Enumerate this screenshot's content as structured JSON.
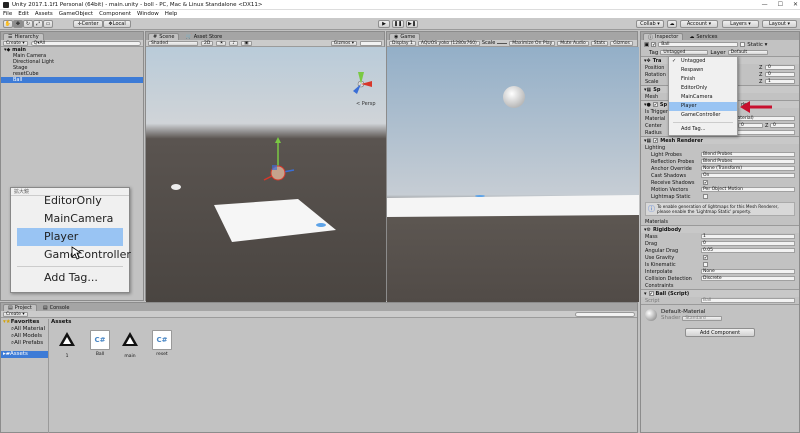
{
  "window": {
    "title": "Unity 2017.1.1f1 Personal (64bit) - main.unity - boll - PC, Mac & Linux Standalone <DX11>",
    "controls": [
      "—",
      "☐",
      "✕"
    ]
  },
  "menu": [
    "File",
    "Edit",
    "Assets",
    "GameObject",
    "Component",
    "Window",
    "Help"
  ],
  "toolbar": {
    "center_label": "Center",
    "local_label": "Local",
    "collab_label": "Collab ▾",
    "account_label": "Account ▾",
    "layers_label": "Layers ▾",
    "layout_label": "Layout ▾"
  },
  "hierarchy": {
    "tab": "Hierarchy",
    "create_label": "Create ▾",
    "search_placeholder": "Q▾All",
    "scene_name": "main",
    "items": [
      "Main Camera",
      "Directional Light",
      "Stage",
      "resetCube",
      "Ball"
    ],
    "selected": "Ball"
  },
  "scene": {
    "tab_scene": "Scene",
    "tab_asset_store": "Asset Store",
    "shading": "Shaded",
    "mode_2d": "2D",
    "gizmos": "Gizmos ▾",
    "persp": "< Persp"
  },
  "game": {
    "tab": "Game",
    "display": "Display 1",
    "resolution": "AQUOS yoko (1280x760)",
    "scale": "Scale",
    "maximize": "Maximize On Play",
    "mute": "Mute Audio",
    "stats": "Stats",
    "gizmos": "Gizmos"
  },
  "zoom_popup": {
    "header": "拡大鏡",
    "items": [
      "EditorOnly",
      "MainCamera",
      "Player",
      "GameController",
      "Add Tag..."
    ],
    "selected": "Player"
  },
  "project": {
    "tab_project": "Project",
    "tab_console": "Console",
    "create_label": "Create ▾",
    "favorites_label": "Favorites",
    "favorites": [
      "All Material",
      "All Models",
      "All Prefabs"
    ],
    "assets_root": "Assets",
    "assets_header": "Assets",
    "assets": [
      {
        "name": "1",
        "icon": "unity-scene-icon"
      },
      {
        "name": "Ball",
        "icon": "csharp-script-icon"
      },
      {
        "name": "main",
        "icon": "unity-scene-icon"
      },
      {
        "name": "reset",
        "icon": "csharp-script-icon"
      }
    ]
  },
  "inspector": {
    "tab_inspector": "Inspector",
    "tab_services": "Services",
    "object_name": "Ball",
    "static_label": "Static ▾",
    "tag_label": "Tag",
    "tag_value": "Untagged",
    "layer_label": "Layer",
    "layer_value": "Default",
    "transform": {
      "title": "Tra",
      "position": {
        "label": "Position",
        "z": "0"
      },
      "rotation": {
        "label": "Rotation",
        "z": "0"
      },
      "scale": {
        "label": "Scale",
        "z": "1"
      }
    },
    "mesh_title": "Sp",
    "mesh_label": "Mesh",
    "collider_title": "Sp",
    "collider_suffix": "der",
    "is_trigger_label": "Is Trigger",
    "material_label": "Material",
    "material_value": "None (Physic Material)",
    "center_label": "Center",
    "center": {
      "x": "0",
      "y": "0",
      "z": "0"
    },
    "radius_label": "Radius",
    "radius_value": "0.5",
    "mesh_renderer": {
      "title": "Mesh Renderer",
      "lighting": "Lighting",
      "rows": [
        {
          "label": "Light Probes",
          "value": "Blend Probes"
        },
        {
          "label": "Reflection Probes",
          "value": "Blend Probes"
        },
        {
          "label": "Anchor Override",
          "value": "None (Transform)"
        },
        {
          "label": "Cast Shadows",
          "value": "On"
        },
        {
          "label": "Receive Shadows",
          "value": "✔"
        },
        {
          "label": "Motion Vectors",
          "value": "Per Object Motion"
        },
        {
          "label": "Lightmap Static",
          "value": ""
        }
      ],
      "info": "To enable generation of lightmaps for this Mesh Renderer, please enable the 'Lightmap Static' property.",
      "materials": "Materials"
    },
    "rigidbody": {
      "title": "Rigidbody",
      "rows": [
        {
          "label": "Mass",
          "value": "1"
        },
        {
          "label": "Drag",
          "value": "0"
        },
        {
          "label": "Angular Drag",
          "value": "0.05"
        },
        {
          "label": "Use Gravity",
          "value": "✔"
        },
        {
          "label": "Is Kinematic",
          "value": ""
        },
        {
          "label": "Interpolate",
          "value": "None"
        },
        {
          "label": "Collision Detection",
          "value": "Discrete"
        }
      ],
      "constraints": "Constraints"
    },
    "ball_script": {
      "title": "Ball (Script)",
      "script_label": "Script",
      "script_value": "Ball"
    },
    "material": {
      "name": "Default-Material",
      "shader_label": "Shader",
      "shader_value": "Standard"
    },
    "add_component": "Add Component"
  },
  "tag_dropdown": {
    "items": [
      "Untagged",
      "Respawn",
      "Finish",
      "EditorOnly",
      "MainCamera",
      "Player",
      "GameController"
    ],
    "add_tag": "Add Tag...",
    "checked": "Untagged",
    "highlighted": "Player"
  },
  "colors": {
    "selection": "#3d7bd6",
    "highlight": "#99c4f3",
    "arrow": "#c8102e"
  }
}
